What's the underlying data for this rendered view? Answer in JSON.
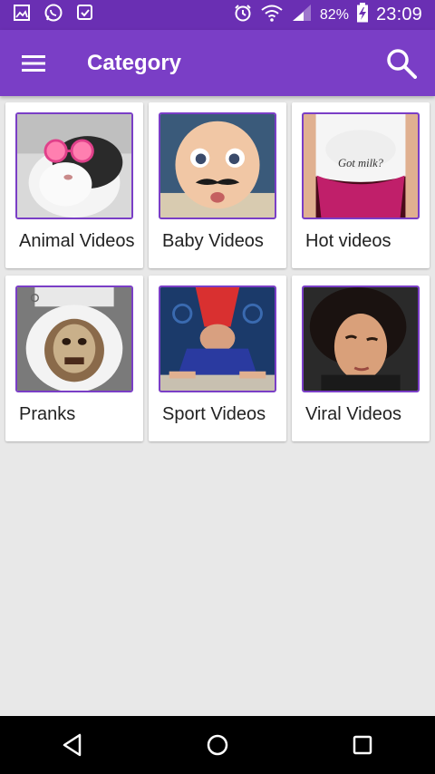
{
  "status_bar": {
    "battery_percent": "82%",
    "time": "23:09",
    "icons": [
      "gallery-icon",
      "whatsapp-icon",
      "message-check-icon",
      "alarm-icon",
      "wifi-icon",
      "signal-icon",
      "battery-charging-icon"
    ]
  },
  "app_bar": {
    "title": "Category",
    "menu_icon": "hamburger-menu-icon",
    "search_icon": "search-icon"
  },
  "categories": [
    {
      "label": "Animal Videos"
    },
    {
      "label": "Baby Videos"
    },
    {
      "label": "Hot videos"
    },
    {
      "label": "Pranks"
    },
    {
      "label": "Sport Videos"
    },
    {
      "label": "Viral Videos"
    }
  ],
  "thumbnail_text": {
    "hot_shirt": "Got milk?"
  },
  "nav_bar": {
    "icons": [
      "back-icon",
      "home-icon",
      "recents-icon"
    ]
  },
  "colors": {
    "status_bar": "#6a2fb3",
    "app_bar": "#7a3ec6",
    "thumb_border": "#7a3ec6",
    "background": "#e8e8e8"
  }
}
